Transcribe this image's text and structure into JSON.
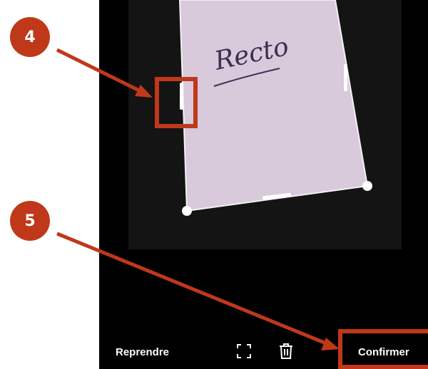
{
  "screen": {
    "document_text": "Recto",
    "buttons": {
      "retake_label": "Reprendre",
      "confirm_label": "Confirmer"
    },
    "icons": {
      "expand": "fullscreen-expand-icon",
      "delete": "trash-icon"
    }
  },
  "annotations": {
    "badge_4": "4",
    "badge_5": "5",
    "accent_color": "#c0381a"
  }
}
